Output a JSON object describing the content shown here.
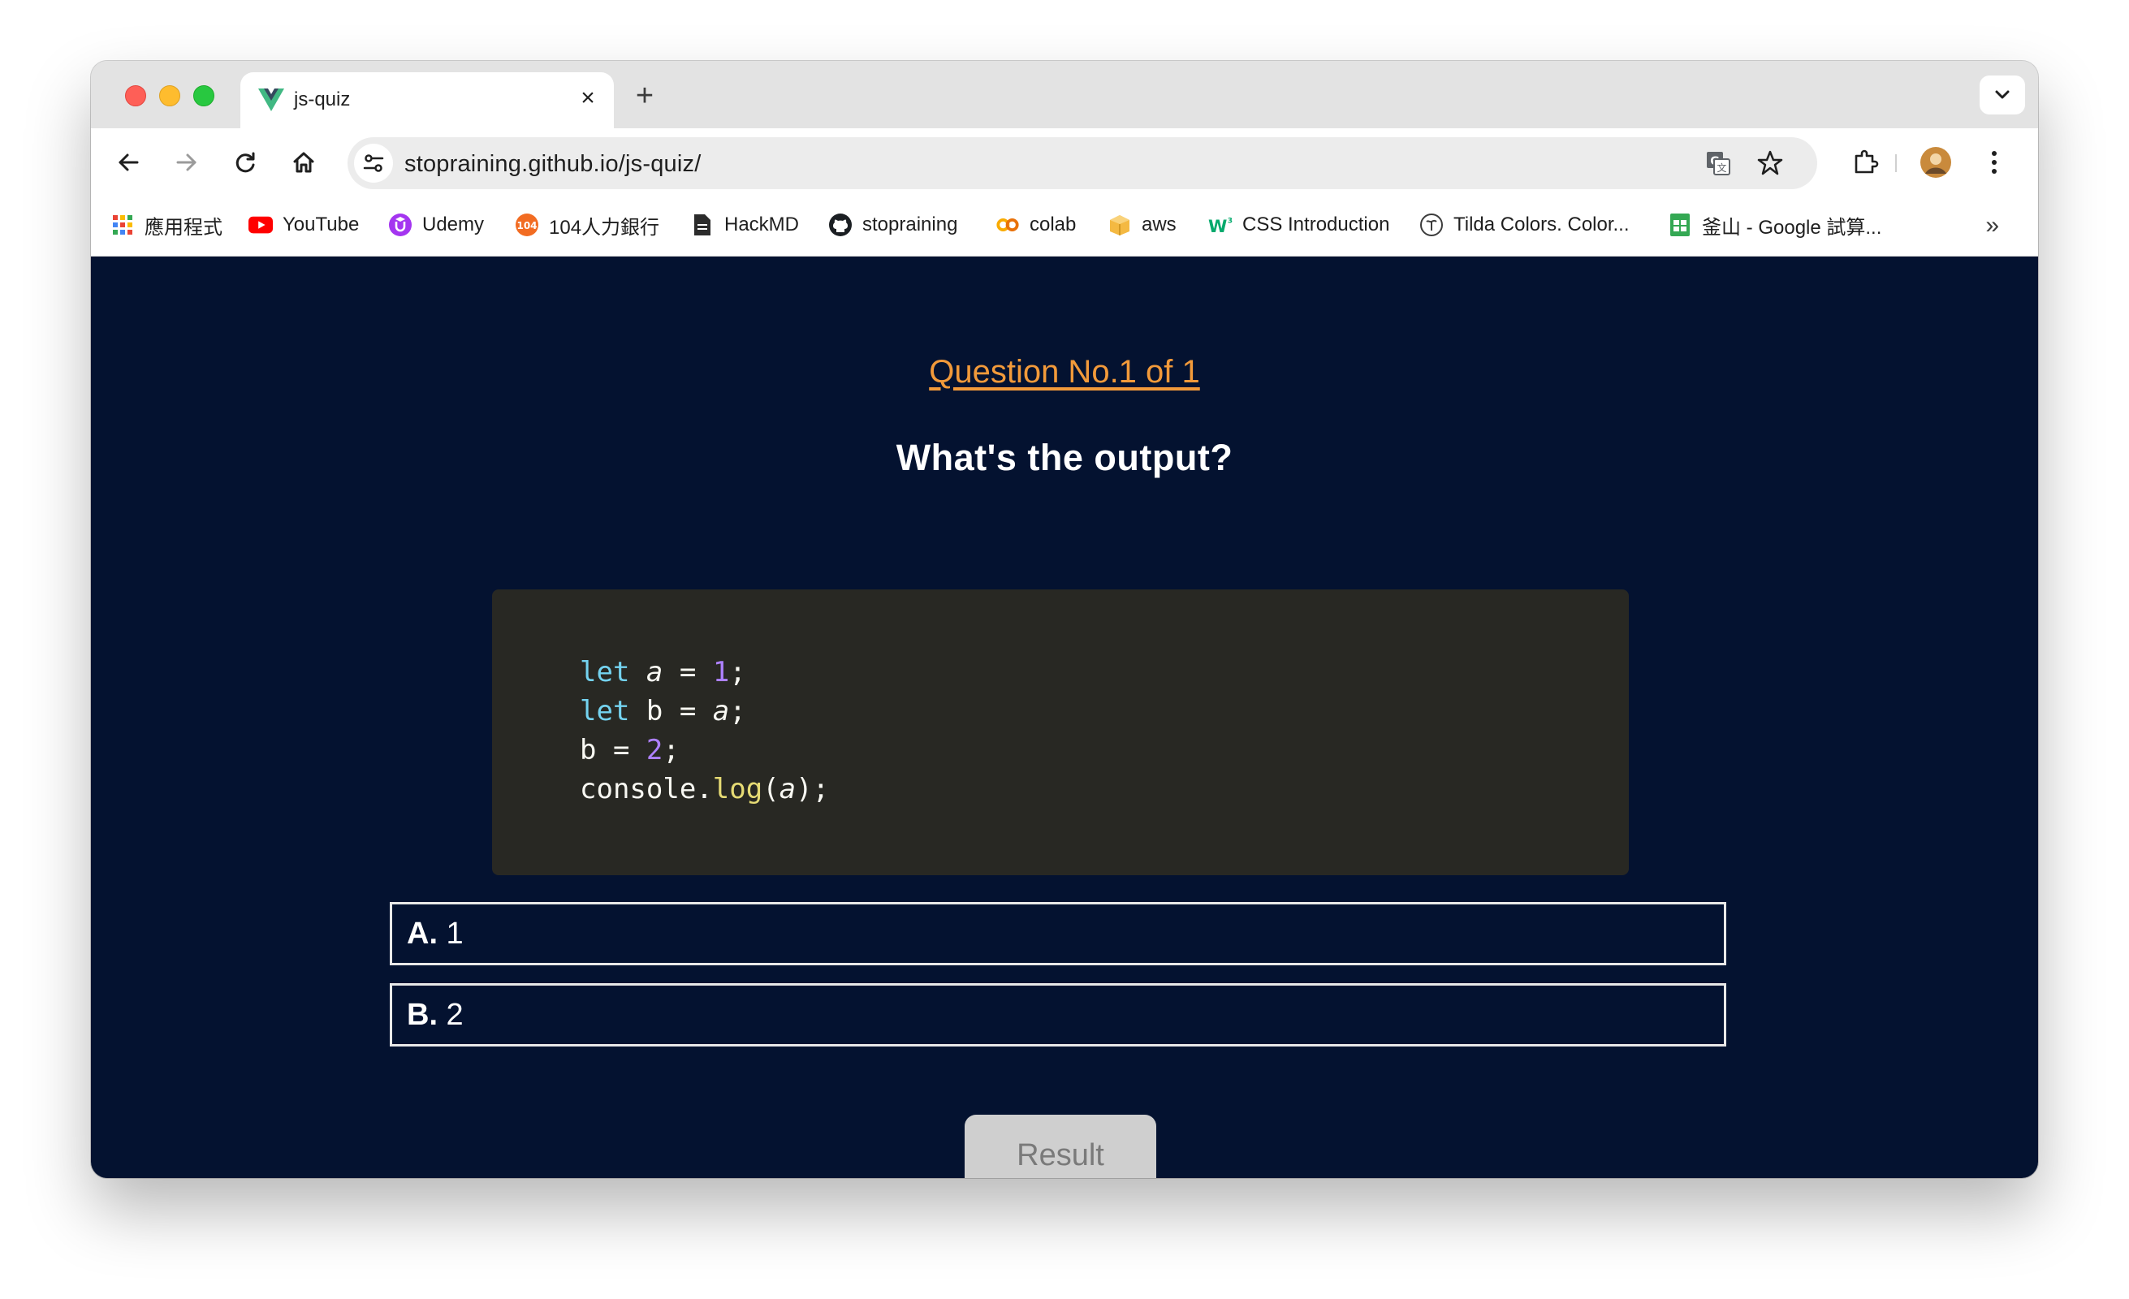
{
  "browser": {
    "tab_title": "js-quiz",
    "url": "stopraining.github.io/js-quiz/",
    "bookmarks": [
      {
        "label": "應用程式",
        "icon": "apps-grid-icon"
      },
      {
        "label": "YouTube",
        "icon": "youtube-icon"
      },
      {
        "label": "Udemy",
        "icon": "udemy-icon"
      },
      {
        "label": "104人力銀行",
        "icon": "104-icon"
      },
      {
        "label": "HackMD",
        "icon": "document-icon"
      },
      {
        "label": "stopraining",
        "icon": "github-icon"
      },
      {
        "label": "colab",
        "icon": "colab-icon"
      },
      {
        "label": "aws",
        "icon": "box-icon"
      },
      {
        "label": "CSS Introduction",
        "icon": "w3schools-icon"
      },
      {
        "label": "Tilda Colors. Color...",
        "icon": "tilda-icon"
      },
      {
        "label": "釜山 - Google 試算...",
        "icon": "sheets-icon"
      }
    ],
    "bookmarks_more": "»"
  },
  "quiz": {
    "counter": "Question No.1 of 1",
    "question": "What's the output?",
    "code_lines": [
      "let a = 1;",
      "let b = a;",
      "b = 2;",
      "console.log(a);"
    ],
    "options": [
      {
        "letter": "A.",
        "text": " 1"
      },
      {
        "letter": "B.",
        "text": " 2"
      }
    ],
    "result_label": "Result"
  },
  "colors": {
    "page_bg": "#041230",
    "accent": "#f29a3a",
    "code_bg": "#282823"
  }
}
